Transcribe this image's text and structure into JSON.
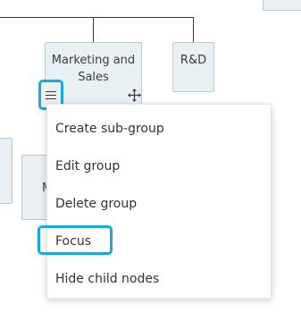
{
  "nodes": {
    "marketing_and_sales": "Marketing and Sales",
    "rnd": "R&D",
    "partial_left_initial": "M"
  },
  "context_menu": {
    "items": [
      "Create sub-group",
      "Edit group",
      "Delete group",
      "Focus",
      "Hide child nodes"
    ]
  },
  "icons": {
    "node_menu": "hamburger-menu-icon",
    "node_move": "move-arrows-icon"
  },
  "colors": {
    "highlight": "#1aa7e0",
    "node_background": "#e9f0f3",
    "node_border": "#b7c8d2",
    "connector": "#3a3a3a"
  }
}
